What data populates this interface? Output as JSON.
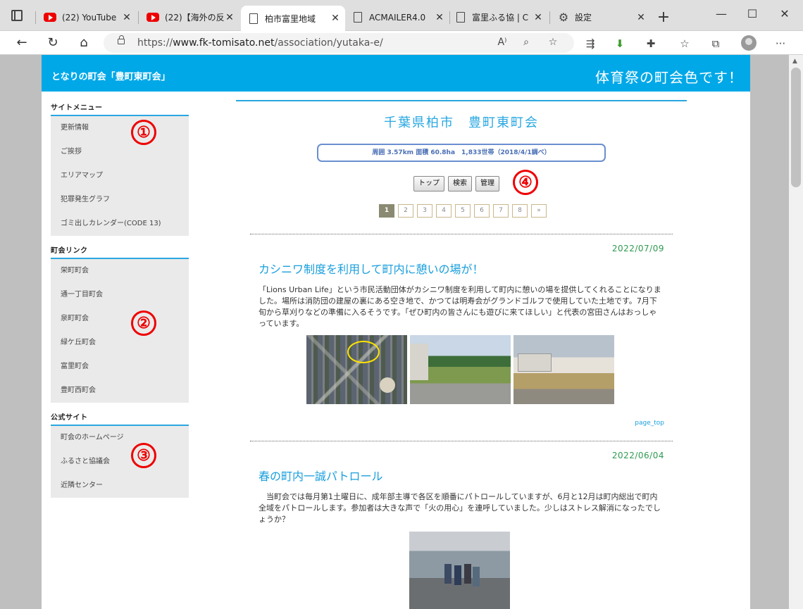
{
  "browser": {
    "tabs": [
      {
        "label": "(22) YouTube",
        "icon": "youtube-icon"
      },
      {
        "label": "(22)【海外の反応",
        "icon": "youtube-icon"
      },
      {
        "label": "柏市富里地域",
        "icon": "page-icon"
      },
      {
        "label": "ACMAILER4.0",
        "icon": "page-icon"
      },
      {
        "label": "富里ふる協 | C",
        "icon": "page-icon"
      },
      {
        "label": "設定",
        "icon": "gear-icon"
      }
    ],
    "url_prefix": "https://",
    "url_host": "www.fk-tomisato.net",
    "url_path": "/association/yutaka-e/"
  },
  "site": {
    "title": "となりの町会「豊町東町会」",
    "tagline": "体育祭の町会色です！"
  },
  "sidebar": {
    "site_menu": {
      "heading": "サイトメニュー",
      "items": [
        "更新情報",
        "ご挨拶",
        "エリアマップ",
        "犯罪発生グラフ",
        "ゴミ出しカレンダー(CODE 13)"
      ]
    },
    "town_links": {
      "heading": "町会リンク",
      "items": [
        "栄町町会",
        "通一丁目町会",
        "泉町町会",
        "緑ケ丘町会",
        "富里町会",
        "豊町西町会"
      ]
    },
    "official": {
      "heading": "公式サイト",
      "items": [
        "町会のホームページ",
        "ふるさと協議会",
        "近隣センター"
      ]
    }
  },
  "markers": [
    "①",
    "②",
    "③",
    "④"
  ],
  "main": {
    "title": "千葉県柏市　豊町東町会",
    "stats": "周囲 3.57km 面積 60.8ha　1,833世帯（2018/4/1調べ）",
    "buttons": [
      "トップ",
      "検索",
      "管理"
    ],
    "pager": [
      "1",
      "2",
      "3",
      "4",
      "5",
      "6",
      "7",
      "8",
      "»"
    ],
    "current_page": "1"
  },
  "posts": [
    {
      "date": "2022/07/09",
      "title": "カシニワ制度を利用して町内に憩いの場が！",
      "body": "「Lions Urban Life」という市民活動団体がカシニワ制度を利用して町内に憩いの場を提供してくれることになりました。場所は消防団の建屋の裏にある空き地で、かつては明寿会がグランドゴルフで使用していた土地です。7月下旬から草刈りなどの準備に入るそうです。「ぜひ町内の皆さんにも遊びに来てほしい」と代表の宮田さんはおっしゃっています。",
      "page_top": "page_top"
    },
    {
      "date": "2022/06/04",
      "title": "春の町内一誠パトロール",
      "body": "　当町会では毎月第1土曜日に、成年部主導で各区を順番にパトロールしていますが、6月と12月は町内総出で町内全域をパトロールします。参加者は大きな声で「火の用心」を連呼していました。少しはストレス解消になったでしょうか？"
    }
  ]
}
